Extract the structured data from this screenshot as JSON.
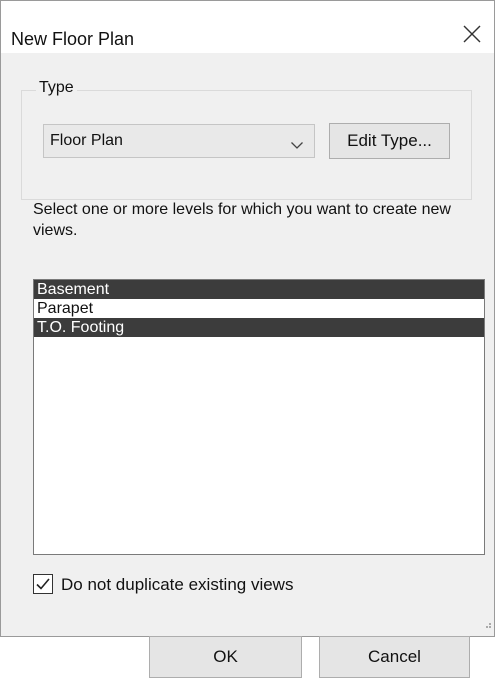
{
  "dialog": {
    "title": "New Floor Plan",
    "close_icon": "close-icon"
  },
  "type_group": {
    "legend": "Type",
    "selected_type": "Floor Plan",
    "dropdown_icon": "chevron-down-icon",
    "edit_type_label": "Edit Type..."
  },
  "instructions": "Select one or more levels for which you want to create new views.",
  "levels": [
    {
      "label": "Basement",
      "selected": true
    },
    {
      "label": "Parapet",
      "selected": false
    },
    {
      "label": "T.O. Footing",
      "selected": true
    }
  ],
  "option": {
    "label": "Do not duplicate existing views",
    "checked": true
  },
  "buttons": {
    "ok": "OK",
    "cancel": "Cancel"
  }
}
